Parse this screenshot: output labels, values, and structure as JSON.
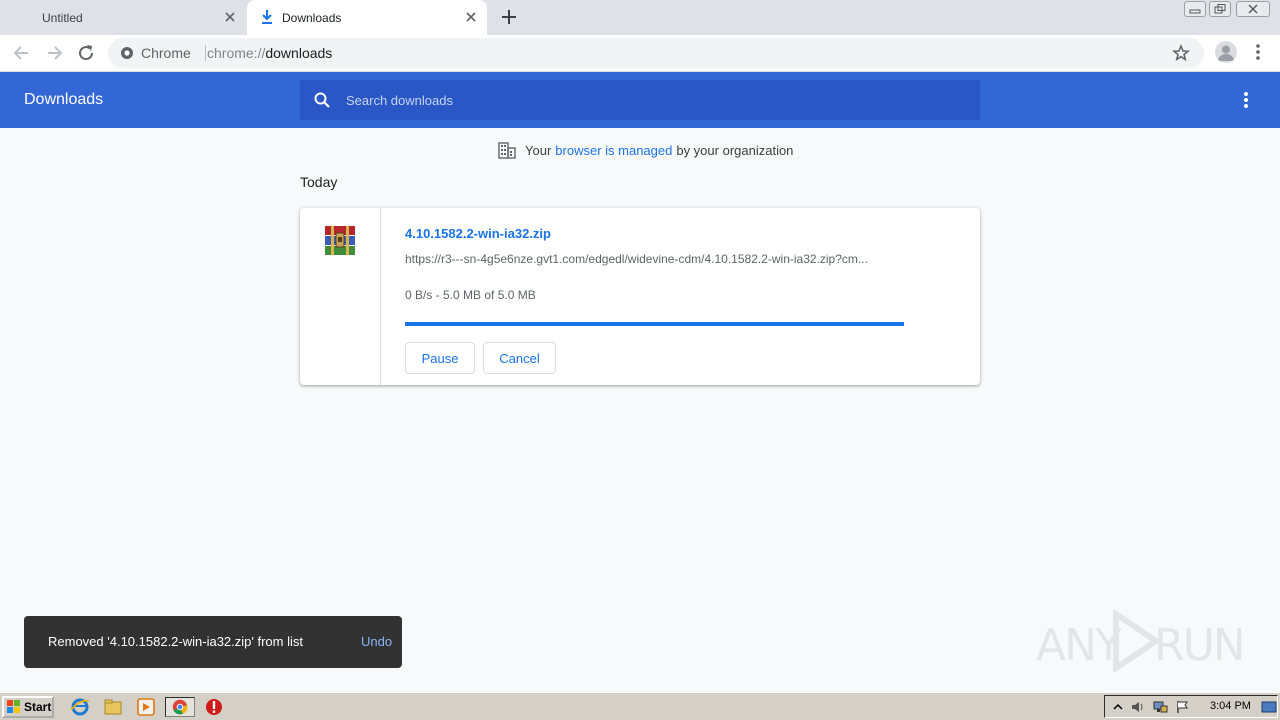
{
  "browser": {
    "tabs": [
      {
        "label": "Untitled",
        "active": false
      },
      {
        "label": "Downloads",
        "active": true
      }
    ],
    "omnibox": {
      "site_label": "Chrome",
      "url_scheme": "chrome://",
      "url_host": "downloads"
    }
  },
  "downloads": {
    "title": "Downloads",
    "search_placeholder": "Search downloads",
    "managed_notice": {
      "prefix": "Your",
      "link_text": "browser is managed",
      "suffix": "by your organization"
    },
    "section_label": "Today",
    "items": [
      {
        "file_name": "4.10.1582.2-win-ia32.zip",
        "url": "https://r3---sn-4g5e6nze.gvt1.com/edgedl/widevine-cdm/4.10.1582.2-win-ia32.zip?cm...",
        "status": "0 B/s - 5.0 MB of 5.0 MB",
        "progress_percent": 100,
        "pause_label": "Pause",
        "cancel_label": "Cancel"
      }
    ]
  },
  "toast": {
    "message": "Removed '4.10.1582.2-win-ia32.zip' from list",
    "action_label": "Undo"
  },
  "watermark": {
    "text": "ANY RUN"
  },
  "taskbar": {
    "start_label": "Start",
    "clock": "3:04 PM"
  },
  "colors": {
    "header": "#3367d6",
    "search": "#2a56c6",
    "accent": "#1a73e8",
    "toast": "#323232"
  }
}
